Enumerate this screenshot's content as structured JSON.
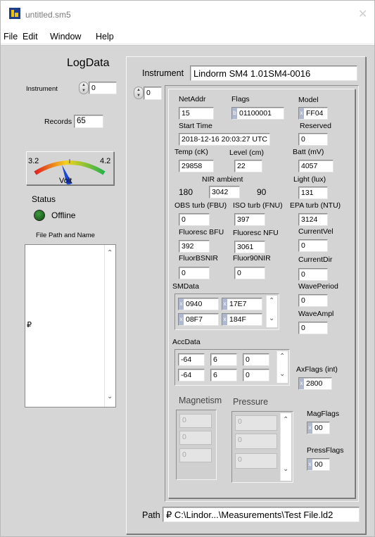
{
  "window": {
    "title": "untitled.sm5",
    "close_glyph": "✕"
  },
  "menu": [
    "File",
    "Edit",
    "Window",
    "Help"
  ],
  "left": {
    "heading": "LogData",
    "instrument_label": "Instrument",
    "instrument_value": "0",
    "records_label": "Records",
    "records_value": "65",
    "gauge": {
      "min": "3.2",
      "max": "4.2",
      "label": "Volt",
      "needle_fraction": 0.38
    },
    "status_label": "Status",
    "status_text": "Offline",
    "status_led_color": "#1e6a1e",
    "filepath_label": "File Path and Name",
    "file_list_glyph": "₽"
  },
  "right": {
    "instrument_label": "Instrument",
    "instrument_value": "Lindorm SM4 1.01SM4-0016",
    "index_value": "0",
    "path_label": "Path",
    "path_glyph": "₽",
    "path_value": "C:\\Lindor...\\Measurements\\Test File.ld2"
  },
  "rec": {
    "netaddr_label": "NetAddr",
    "netaddr": "15",
    "flags_label": "Flags",
    "flags_radix": "b",
    "flags": "01100001",
    "model_label": "Model",
    "model_radix": "x",
    "model": "FF04",
    "starttime_label": "Start Time",
    "starttime": "2018-12-16 20:03:27 UTC",
    "reserved_label": "Reserved",
    "reserved": "0",
    "temp_label": "Temp (cK)",
    "temp": "29858",
    "level_label": "Level (cm)",
    "level": "22",
    "batt_label": "Batt (mV)",
    "batt": "4057",
    "nir_label": "NIR ambient",
    "nir_180_label": "180",
    "nir": "3042",
    "nir_90_label": "90",
    "light_label": "Light (lux)",
    "light": "131",
    "obs_label": "OBS turb (FBU)",
    "obs": "0",
    "iso_label": "ISO turb (FNU)",
    "iso": "397",
    "epa_label": "EPA turb (NTU)",
    "epa": "3124",
    "fbfu_label": "Fluoresc BFU",
    "fbfu": "392",
    "fnfu_label": "Fluoresc NFU",
    "fnfu": "3061",
    "curvel_label": "CurrentVel",
    "curvel": "0",
    "fbsnir_label": "FluorBSNIR",
    "fbsnir": "0",
    "f90nir_label": "Fluor90NIR",
    "f90nir": "0",
    "curdir_label": "CurrentDir",
    "curdir": "0",
    "smdata_label": "SMData",
    "smdata": [
      [
        "0940",
        "17E7"
      ],
      [
        "08F7",
        "184F"
      ]
    ],
    "smdata_radix": "x",
    "waveper_label": "WavePeriod",
    "waveper": "0",
    "waveampl_label": "WaveAmpl",
    "waveampl": "0",
    "accdata_label": "AccData",
    "accdata": [
      [
        "-64",
        "6",
        "0"
      ],
      [
        "-64",
        "6",
        "0"
      ]
    ],
    "axflags_label": "AxFlags (int)",
    "axflags_radix": "x",
    "axflags": "2800",
    "magnetism_label": "Magnetism",
    "magnetism": [
      "0",
      "0",
      "0"
    ],
    "pressure_label": "Pressure",
    "pressure": [
      "0",
      "0",
      "0"
    ],
    "magflags_label": "MagFlags",
    "magflags_radix": "x",
    "magflags": "00",
    "pressflags_label": "PressFlags",
    "pressflags_radix": "x",
    "pressflags": "00"
  },
  "icons": {
    "app": "app-icon",
    "close": "close-icon",
    "up": "▲",
    "down": "▼",
    "scroll_up": "⌃",
    "scroll_down": "⌄"
  }
}
